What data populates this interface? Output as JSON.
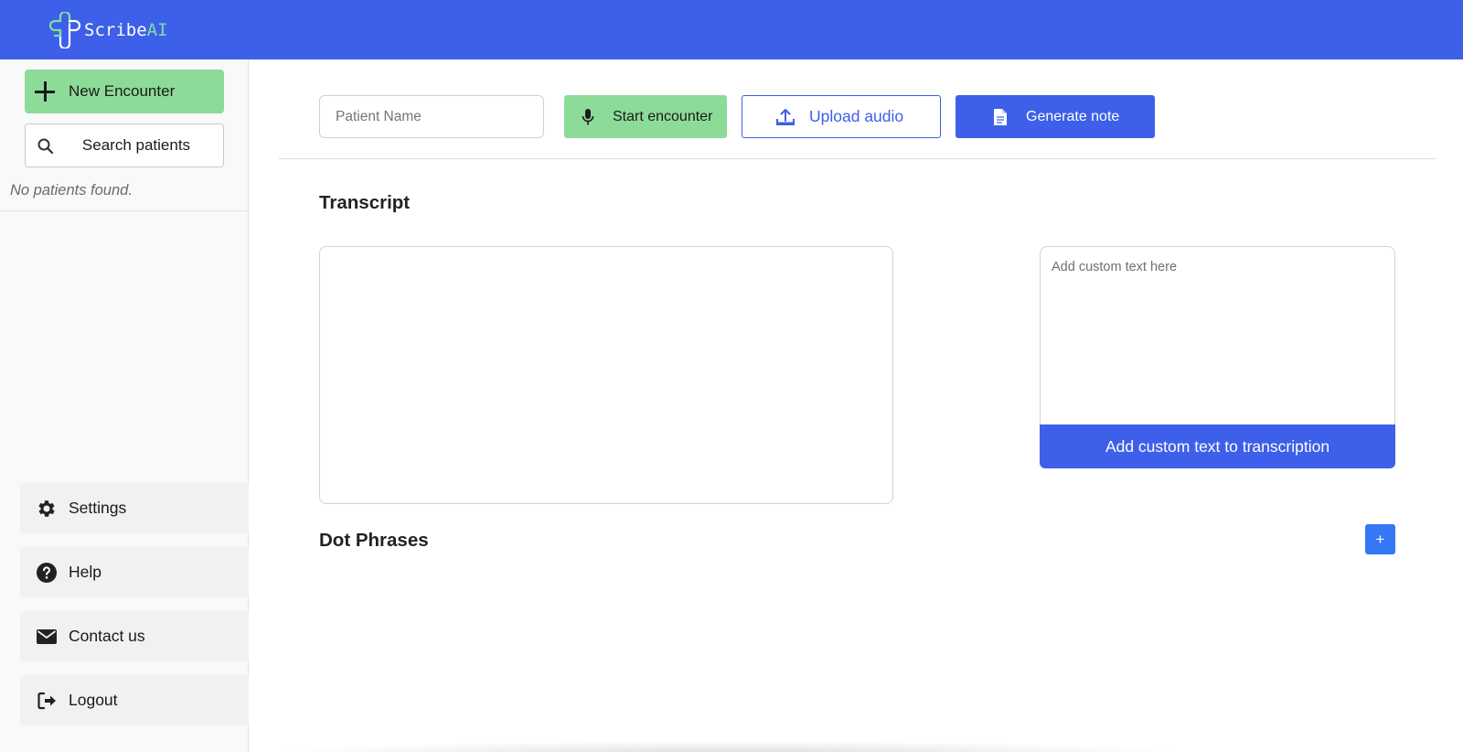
{
  "app": {
    "logo_text_primary": "Scribe",
    "logo_text_accent": "AI",
    "brand_color": "#3d5fe9",
    "accent_green": "#8ddb98"
  },
  "sidebar": {
    "new_encounter_label": "New Encounter",
    "search_label": "Search patients",
    "empty_message": "No patients found.",
    "items": [
      {
        "label": "Settings",
        "icon": "gear-icon"
      },
      {
        "label": "Help",
        "icon": "question-circle-icon"
      },
      {
        "label": "Contact us",
        "icon": "envelope-icon"
      },
      {
        "label": "Logout",
        "icon": "logout-icon"
      }
    ]
  },
  "toolbar": {
    "patient_name_placeholder": "Patient Name",
    "start_label": "Start encounter",
    "upload_label": "Upload audio",
    "generate_label": "Generate note"
  },
  "main": {
    "transcript_heading": "Transcript",
    "custom_text_placeholder": "Add custom text here",
    "add_custom_label": "Add custom text to transcription",
    "dot_phrases_heading": "Dot Phrases",
    "add_dot_phrase_label": "+"
  }
}
